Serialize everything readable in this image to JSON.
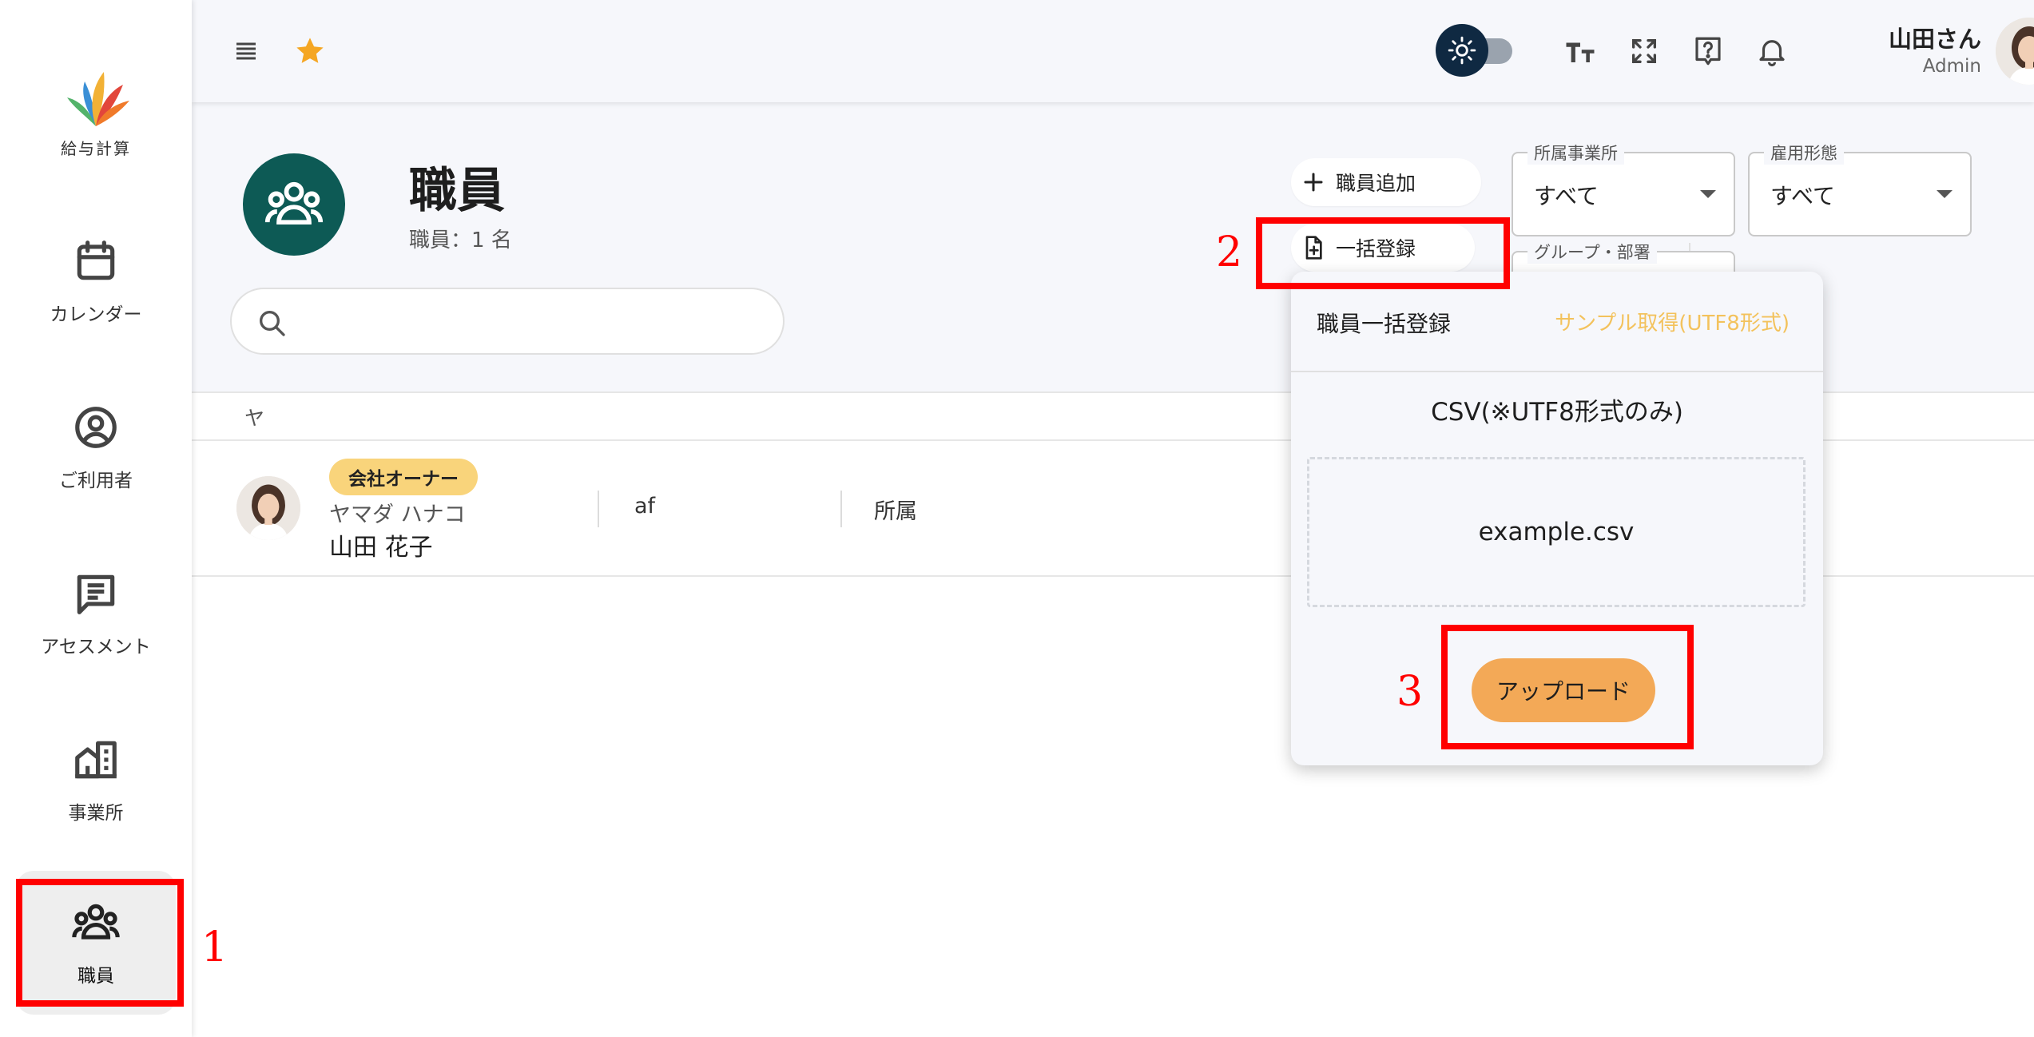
{
  "sidebar": {
    "logo_text": "給与計算",
    "items": [
      {
        "label": "カレンダー",
        "icon": "calendar-icon"
      },
      {
        "label": "ご利用者",
        "icon": "user-circle-icon"
      },
      {
        "label": "アセスメント",
        "icon": "message-lines-icon"
      },
      {
        "label": "事業所",
        "icon": "office-building-icon"
      },
      {
        "label": "職員",
        "icon": "group-icon",
        "active": true
      }
    ]
  },
  "topbar": {
    "menu_icon": "menu-icon",
    "favorite_icon": "star-icon",
    "theme_toggle_icon": "sun-icon",
    "font_size_icon": "text-size-icon",
    "fullscreen_icon": "fullscreen-icon",
    "help_icon": "help-icon",
    "notification_icon": "bell-icon",
    "user": {
      "name": "山田さん",
      "role": "Admin"
    }
  },
  "page": {
    "title": "職員",
    "count": "職員：1 名",
    "search_placeholder": ""
  },
  "actions": {
    "add_staff": "職員追加",
    "bulk_register": "一括登録"
  },
  "filters": [
    {
      "legend": "所属事業所",
      "value": "すべて"
    },
    {
      "legend": "雇用形態",
      "value": "すべて"
    },
    {
      "legend": "グループ・部署",
      "value": ""
    }
  ],
  "table": {
    "header": "ヤ",
    "rows": [
      {
        "badge": "会社オーナー",
        "kana": "ヤマダ ハナコ",
        "name": "山田 花子",
        "col2": "af",
        "col3": "所属"
      }
    ]
  },
  "popup": {
    "title": "職員一括登録",
    "sample_link": "サンプル取得(UTF8形式)",
    "csv_label": "CSV(※UTF8形式のみ)",
    "file_name": "example.csv",
    "upload_button": "アップロード"
  },
  "annotations": [
    "1",
    "2",
    "3"
  ],
  "colors": {
    "accent_teal": "#0d5a55",
    "badge_yellow": "#f9d47b",
    "upload_orange": "#f3a957",
    "link_yellow": "#f3c25c",
    "annotation_red": "#ff0000",
    "star": "#f5a623"
  }
}
